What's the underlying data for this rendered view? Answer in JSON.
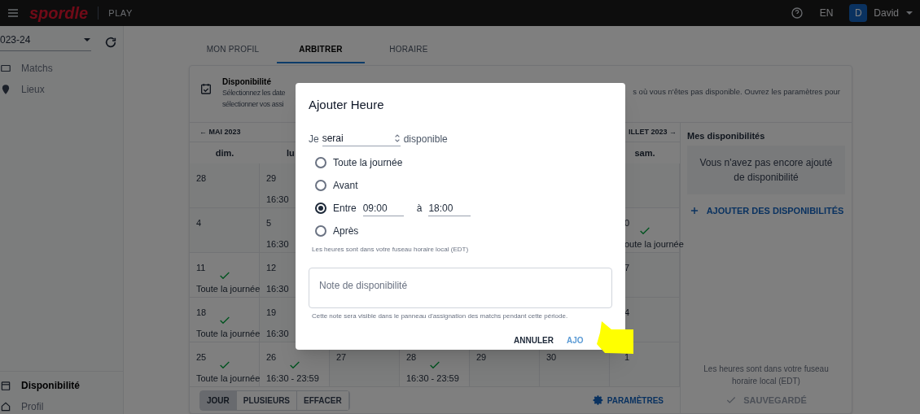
{
  "header": {
    "logo": "spordle",
    "product": "PLAY",
    "language": "EN",
    "avatar_initial": "D",
    "user": "David"
  },
  "sidebar": {
    "season": "023-24",
    "items": [
      {
        "label": "Matchs",
        "selected": false
      },
      {
        "label": "Lieux",
        "selected": false
      }
    ],
    "bottom_items": [
      {
        "label": "Disponibilité",
        "selected": true
      },
      {
        "label": "Profil",
        "selected": false
      }
    ]
  },
  "tabs": [
    {
      "label": "MON PROFIL",
      "selected": false
    },
    {
      "label": "ARBITRER",
      "selected": true
    },
    {
      "label": "HORAIRE",
      "selected": false
    }
  ],
  "info": {
    "title": "Disponibilité",
    "text_left": [
      "Sélectionnez les date",
      "sélectionner vos assi"
    ],
    "text_right": "s où vous n'êtes pas disponible. Ouvrez les paramètres pour"
  },
  "calendar": {
    "prev": "← MAI 2023",
    "next": "ILLET 2023 →",
    "weekdays": [
      "dim.",
      "lu",
      "sam."
    ],
    "weeks": [
      [
        {
          "day": "28",
          "available": false
        },
        {
          "day": "29",
          "time": "16:30",
          "available": false
        },
        {
          "available": false
        }
      ],
      [
        {
          "day": "4",
          "available": false
        },
        {
          "day": "5",
          "time": "16:30",
          "available": false
        },
        {
          "day": "0",
          "time": "oute la journée",
          "available": true
        }
      ],
      [
        {
          "day": "11",
          "time": "Toute la journée",
          "available": true
        },
        {
          "day": "12",
          "time": "16:30",
          "available": false
        },
        {
          "day": "7",
          "available": false
        }
      ],
      [
        {
          "day": "18",
          "time": "Toute la journée",
          "available": true
        },
        {
          "day": "19",
          "time": "16:30",
          "available": false
        },
        {
          "day": "4",
          "available": false
        }
      ],
      [
        {
          "day": "25",
          "time": "Toute la journée",
          "available": true
        },
        {
          "day": "26",
          "time": "16:30 - 23:59",
          "available": true
        },
        {
          "day": "27",
          "available": false
        },
        {
          "day": "28",
          "time": "16:30 - 23:59",
          "available": true
        },
        {
          "day": "29",
          "available": false
        },
        {
          "day": "30",
          "available": false
        },
        {
          "day": "1",
          "available": false
        }
      ]
    ],
    "modes": [
      {
        "label": "JOUR",
        "selected": true
      },
      {
        "label": "PLUSIEURS",
        "selected": false
      },
      {
        "label": "EFFACER",
        "selected": false
      }
    ],
    "settings": "PARAMÈTRES"
  },
  "availability_panel": {
    "title": "Mes disponibilités",
    "empty": "Vous n'avez pas encore ajouté de disponibilité",
    "add": "AJOUTER DES DISPONIBILITÉS",
    "timezone": "Les heures sont dans votre fuseau horaire local (EDT)",
    "saved": "SAUVEGARDÉ"
  },
  "dialog": {
    "title": "Ajouter Heure",
    "prefix": "Je",
    "select_value": "serai",
    "suffix": "disponible",
    "options": [
      {
        "kind": "plain",
        "label": "Toute la journée",
        "selected": false
      },
      {
        "kind": "plain",
        "label": "Avant",
        "selected": false
      },
      {
        "kind": "range",
        "label": "Entre",
        "from": "09:00",
        "between": "à",
        "to": "18:00",
        "selected": true
      },
      {
        "kind": "plain",
        "label": "Après",
        "selected": false
      }
    ],
    "hint": "Les heures sont dans votre fuseau horaire local (EDT)",
    "note_placeholder": "Note de disponibilité",
    "note_hint": "Cette note sera visible dans le panneau d'assignation des matchs pendant cette période.",
    "cancel": "ANNULER",
    "confirm": "AJO"
  }
}
